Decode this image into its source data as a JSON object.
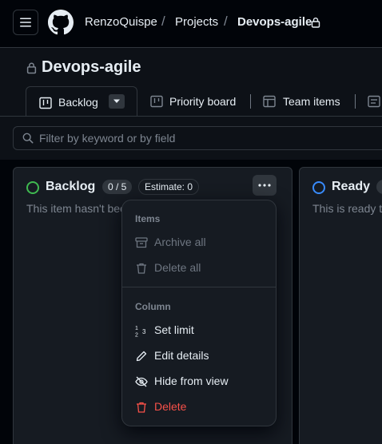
{
  "breadcrumb": {
    "owner": "RenzoQuispe",
    "section": "Projects",
    "project": "Devops-agile",
    "separator": "/"
  },
  "page": {
    "title": "Devops-agile"
  },
  "tabs": [
    {
      "label": "Backlog",
      "icon": "table-icon",
      "active": true
    },
    {
      "label": "Priority board",
      "icon": "board-icon",
      "active": false
    },
    {
      "label": "Team items",
      "icon": "table-icon",
      "active": false
    }
  ],
  "filter": {
    "placeholder": "Filter by keyword or by field"
  },
  "columns": [
    {
      "name": "Backlog",
      "status_color": "#3fb950",
      "count": "0 / 5",
      "estimate": "Estimate: 0",
      "description": "This item hasn't been started"
    },
    {
      "name": "Ready",
      "status_color": "#388bfd",
      "description": "This is ready to be picked up"
    }
  ],
  "menu": {
    "items_heading": "Items",
    "archive_all": "Archive all",
    "delete_all": "Delete all",
    "column_heading": "Column",
    "set_limit": "Set limit",
    "edit_details": "Edit details",
    "hide_from_view": "Hide from view",
    "delete": "Delete"
  },
  "colors": {
    "background": "#0d1117",
    "border": "#30363d",
    "muted": "#7d8590",
    "danger": "#f85149"
  }
}
